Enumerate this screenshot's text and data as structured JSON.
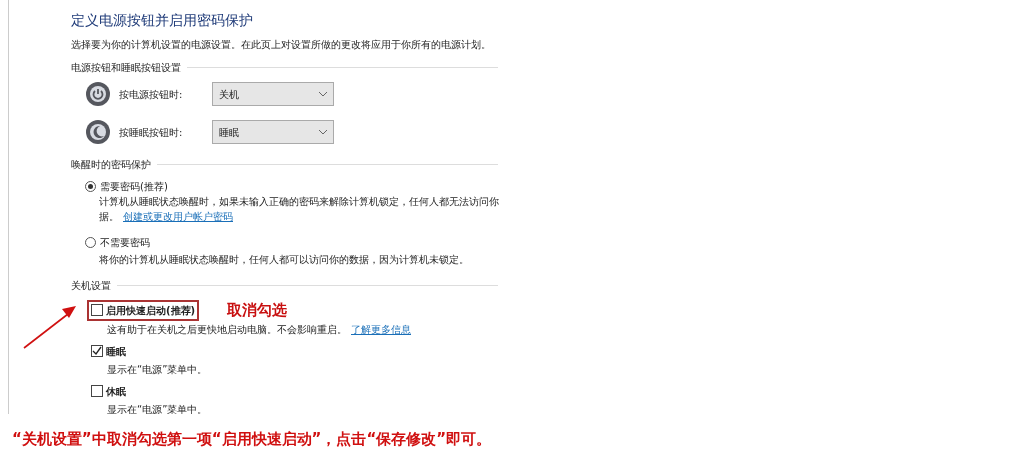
{
  "title": "定义电源按钮并启用密码保护",
  "subtitle": "选择要为你的计算机设置的电源设置。在此页上对设置所做的更改将应用于你所有的电源计划。",
  "button_settings": {
    "heading": "电源按钮和睡眠按钮设置",
    "rows": [
      {
        "kind": "power",
        "label": "按电源按钮时:",
        "value": "关机"
      },
      {
        "kind": "sleep",
        "label": "按睡眠按钮时:",
        "value": "睡眠"
      }
    ]
  },
  "password_protection": {
    "heading": "唤醒时的密码保护",
    "options": [
      {
        "label": "需要密码(推荐)",
        "selected": true,
        "description": "计算机从睡眠状态唤醒时，如果未输入正确的密码来解除计算机锁定，任何人都无法访问你",
        "description_2": "据。",
        "link": "创建或更改用户帐户密码"
      },
      {
        "label": "不需要密码",
        "selected": false,
        "description": "将你的计算机从睡眠状态唤醒时，任何人都可以访问你的数据，因为计算机未锁定。"
      }
    ]
  },
  "shutdown_settings": {
    "heading": "关机设置",
    "items": [
      {
        "label": "启用快速启动(推荐)",
        "checked": false,
        "highlighted": true,
        "description": "这有助于在关机之后更快地启动电脑。不会影响重启。",
        "link": "了解更多信息"
      },
      {
        "label": "睡眠",
        "checked": true,
        "highlighted": false,
        "description": "显示在“电源”菜单中。"
      },
      {
        "label": "休眠",
        "checked": false,
        "highlighted": false,
        "description": "显示在“电源”菜单中。"
      }
    ]
  },
  "annotation": {
    "note": "取消勾选",
    "caption": "“关机设置”中取消勾选第一项“启用快速启动”，点击“保存修改”即可。"
  }
}
